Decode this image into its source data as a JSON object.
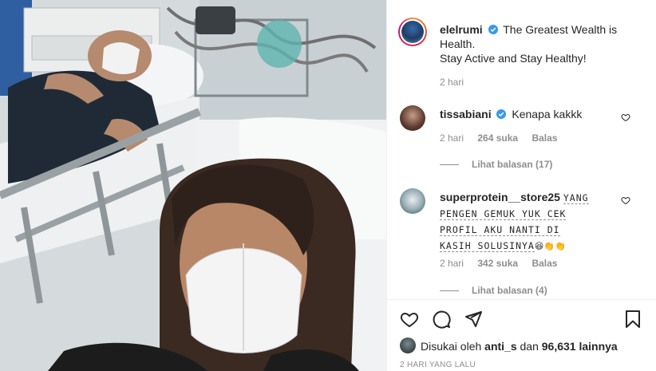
{
  "post": {
    "author": "elelrumi",
    "caption_line1": "The Greatest Wealth is",
    "caption_line2": "Health.",
    "caption_line3": "Stay Active and Stay Healthy!",
    "time": "2 hari"
  },
  "comments": [
    {
      "username": "tissabiani",
      "verified": true,
      "text": "Kenapa kakkk",
      "time": "2 hari",
      "likes": "264 suka",
      "reply_label": "Balas",
      "view_replies": "Lihat balasan (17)"
    },
    {
      "username": "superprotein__store25",
      "verified": false,
      "text_lines": [
        "YANG",
        "PENGEN GEMUK YUK CEK",
        "PROFIL AKU NANTI DI",
        "KASIH SOLUSINYA"
      ],
      "emoji": "😆👏👏",
      "time": "2 hari",
      "likes": "342 suka",
      "reply_label": "Balas",
      "view_replies": "Lihat balasan (4)"
    }
  ],
  "likes_summary": {
    "prefix": "Disukai oleh",
    "user": "anti_s",
    "middle": "dan",
    "count": "96,631 lainnya"
  },
  "timestamp": "2 HARI YANG LALU",
  "icons": {
    "like": "heart-icon",
    "comment": "comment-icon",
    "share": "share-icon",
    "save": "bookmark-icon"
  },
  "colors": {
    "verified": "#3897f0",
    "text": "#262626",
    "muted": "#8e8e8e"
  }
}
